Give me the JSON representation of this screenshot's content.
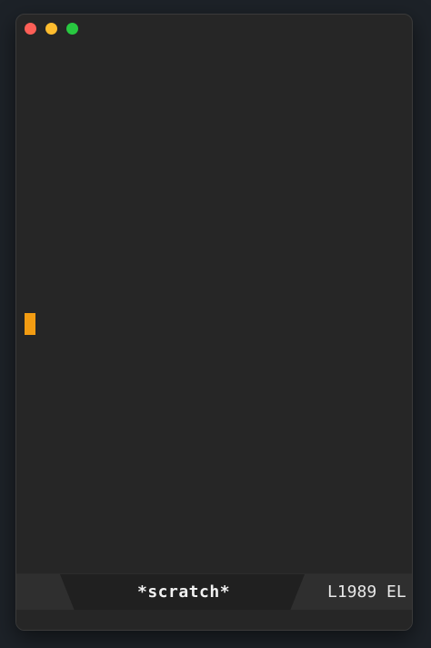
{
  "window": {
    "controls": [
      "close",
      "minimize",
      "maximize"
    ]
  },
  "editor": {
    "content": "",
    "cursor_color": "#f39c12"
  },
  "modeline": {
    "buffer_name": "*scratch*",
    "position": "L1989 EL"
  },
  "colors": {
    "background": "#262626",
    "accent": "#f39c12"
  }
}
